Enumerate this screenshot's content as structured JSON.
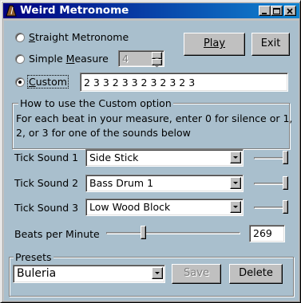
{
  "window": {
    "title": "Weird Metronome",
    "accent": "#000080",
    "client_bg": "#a9bfcd"
  },
  "title_buttons": [
    "minimize",
    "maximize",
    "close"
  ],
  "mode": {
    "options": [
      {
        "label": "Straight Metronome",
        "mnemonic": "S",
        "selected": false
      },
      {
        "label": "Simple Measure",
        "mnemonic": "M",
        "selected": false
      },
      {
        "label": "Custom",
        "mnemonic": "C",
        "selected": true
      }
    ],
    "measure_value": "4",
    "custom_pattern": "2 3 3 2 3 3 2 3 2 3 2 3"
  },
  "buttons": {
    "play": "Play",
    "exit": "Exit",
    "save": "Save",
    "delete": "Delete"
  },
  "help": {
    "title": "How to use the Custom option",
    "text_line1": "For each beat in your measure, enter 0 for silence or 1,",
    "text_line2": "2, or 3 for one of the sounds below"
  },
  "ticks": [
    {
      "label": "Tick Sound 1",
      "sound": "Side Stick",
      "volume": 1.0
    },
    {
      "label": "Tick Sound 2",
      "sound": "Bass Drum 1",
      "volume": 1.0
    },
    {
      "label": "Tick Sound 3",
      "sound": "Low Wood Block",
      "volume": 1.0
    }
  ],
  "tempo": {
    "label": "Beats per Minute",
    "value": "269"
  },
  "presets": {
    "title": "Presets",
    "selected": "Buleria"
  }
}
